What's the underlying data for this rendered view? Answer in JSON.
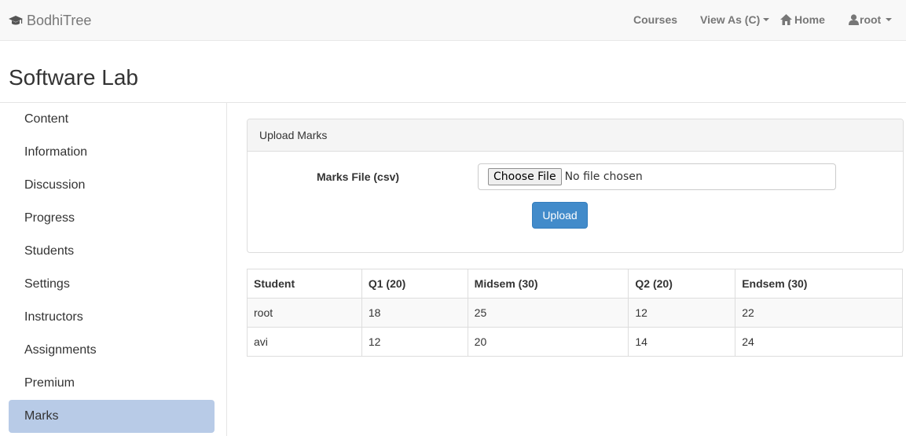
{
  "navbar": {
    "brand": "BodhiTree",
    "links": {
      "courses": "Courses",
      "view_as": "View As (C)",
      "home": "Home",
      "user": "root"
    }
  },
  "page": {
    "title": "Software Lab"
  },
  "sidebar": {
    "items": [
      {
        "label": "Content"
      },
      {
        "label": "Information"
      },
      {
        "label": "Discussion"
      },
      {
        "label": "Progress"
      },
      {
        "label": "Students"
      },
      {
        "label": "Settings"
      },
      {
        "label": "Instructors"
      },
      {
        "label": "Assignments"
      },
      {
        "label": "Premium"
      },
      {
        "label": "Marks"
      }
    ],
    "active": "Marks"
  },
  "upload_panel": {
    "heading": "Upload Marks",
    "field_label": "Marks File (csv)",
    "choose_file_label": "Choose File",
    "file_status": "No file chosen",
    "upload_label": "Upload"
  },
  "marks_table": {
    "columns": [
      "Student",
      "Q1 (20)",
      "Midsem (30)",
      "Q2 (20)",
      "Endsem (30)"
    ],
    "rows": [
      [
        "root",
        "18",
        "25",
        "12",
        "22"
      ],
      [
        "avi",
        "12",
        "20",
        "14",
        "24"
      ]
    ]
  },
  "colors": {
    "navbar_bg": "#f8f8f8",
    "active_sidebar_bg": "#b8cbe7",
    "primary_button": "#428bca"
  }
}
